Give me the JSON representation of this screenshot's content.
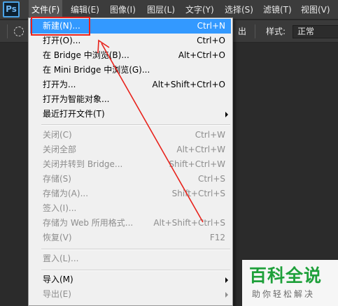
{
  "app": {
    "logo": "Ps"
  },
  "menubar": {
    "items": [
      {
        "label": "文件(F)"
      },
      {
        "label": "编辑(E)"
      },
      {
        "label": "图像(I)"
      },
      {
        "label": "图层(L)"
      },
      {
        "label": "文字(Y)"
      },
      {
        "label": "选择(S)"
      },
      {
        "label": "滤镜(T)"
      },
      {
        "label": "视图(V)"
      }
    ]
  },
  "options": {
    "partial_text": "出",
    "style_label": "样式:",
    "style_value": "正常"
  },
  "file_menu": {
    "items": [
      {
        "label": "新建(N)...",
        "shortcut": "Ctrl+N",
        "state": "highlighted"
      },
      {
        "label": "打开(O)...",
        "shortcut": "Ctrl+O",
        "state": "enabled"
      },
      {
        "label": "在 Bridge 中浏览(B)...",
        "shortcut": "Alt+Ctrl+O",
        "state": "enabled"
      },
      {
        "label": "在 Mini Bridge 中浏览(G)...",
        "shortcut": "",
        "state": "enabled"
      },
      {
        "label": "打开为...",
        "shortcut": "Alt+Shift+Ctrl+O",
        "state": "enabled"
      },
      {
        "label": "打开为智能对象...",
        "shortcut": "",
        "state": "enabled"
      },
      {
        "label": "最近打开文件(T)",
        "shortcut": "",
        "state": "enabled",
        "submenu": true
      },
      {
        "label": "关闭(C)",
        "shortcut": "Ctrl+W",
        "state": "disabled"
      },
      {
        "label": "关闭全部",
        "shortcut": "Alt+Ctrl+W",
        "state": "disabled"
      },
      {
        "label": "关闭并转到 Bridge...",
        "shortcut": "Shift+Ctrl+W",
        "state": "disabled"
      },
      {
        "label": "存储(S)",
        "shortcut": "Ctrl+S",
        "state": "disabled"
      },
      {
        "label": "存储为(A)...",
        "shortcut": "Shift+Ctrl+S",
        "state": "disabled"
      },
      {
        "label": "签入(I)...",
        "shortcut": "",
        "state": "disabled"
      },
      {
        "label": "存储为 Web 所用格式...",
        "shortcut": "Alt+Shift+Ctrl+S",
        "state": "disabled"
      },
      {
        "label": "恢复(V)",
        "shortcut": "F12",
        "state": "disabled"
      },
      {
        "label": "置入(L)...",
        "shortcut": "",
        "state": "disabled"
      },
      {
        "label": "导入(M)",
        "shortcut": "",
        "state": "enabled",
        "submenu": true
      },
      {
        "label": "导出(E)",
        "shortcut": "",
        "state": "disabled",
        "submenu": true
      }
    ]
  },
  "annotation": {
    "color": "#e8221b"
  },
  "colors": {
    "menubar_bg": "#3c3c3c",
    "menu_bg": "#f0f0f0",
    "highlight": "#3399ff",
    "disabled_text": "#8d8d8d"
  },
  "watermark": {
    "title": "百科全说",
    "subtitle": "助你轻松解决",
    "color": "#1ea03a"
  }
}
